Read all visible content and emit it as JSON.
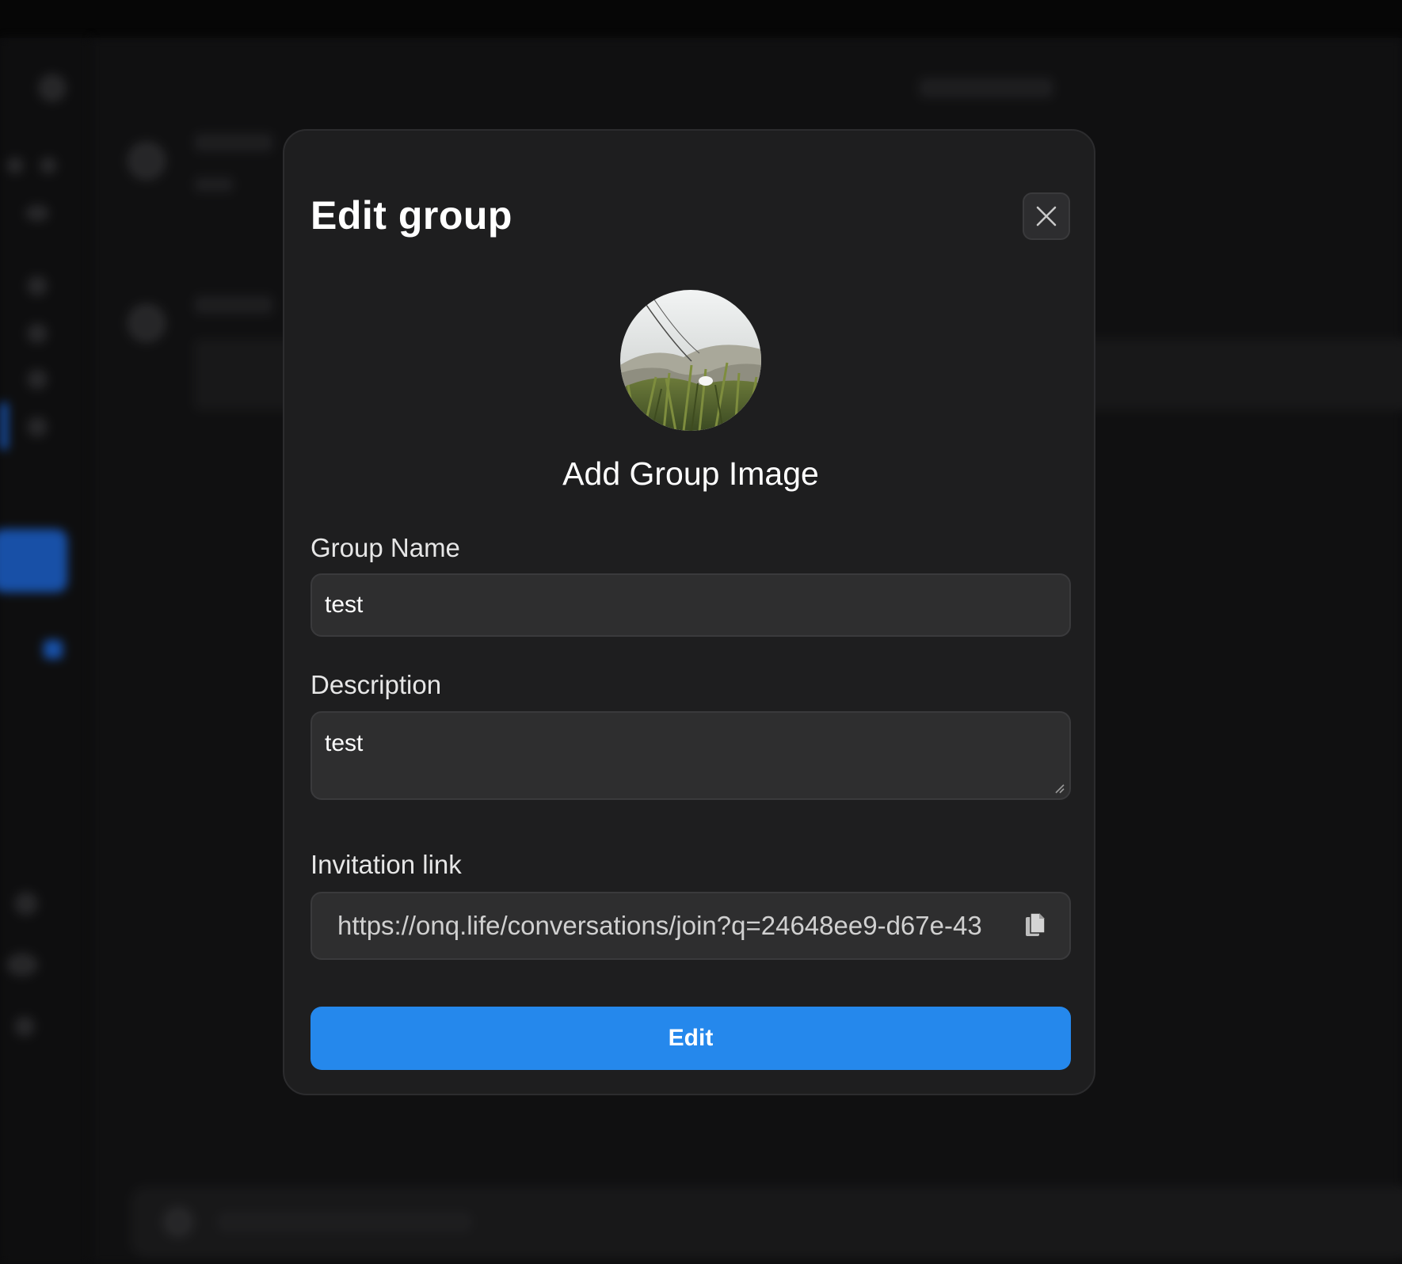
{
  "modal": {
    "title": "Edit group",
    "close_icon": "close-icon",
    "add_image_label": "Add Group Image",
    "group_name": {
      "label": "Group Name",
      "value": "test"
    },
    "description": {
      "label": "Description",
      "value": "test"
    },
    "invitation": {
      "label": "Invitation link",
      "value": "https://onq.life/conversations/join?q=24648ee9-d67e-43",
      "copy_icon": "copy-icon"
    },
    "submit_label": "Edit"
  },
  "colors": {
    "accent": "#2588ec",
    "modal_bg": "#1e1e1f",
    "input_bg": "#2e2e2f"
  }
}
